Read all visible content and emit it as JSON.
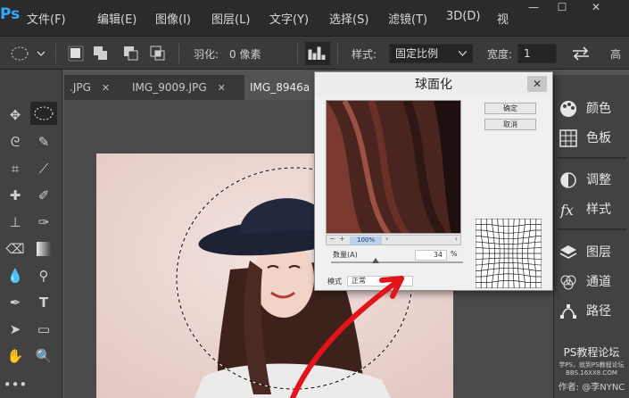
{
  "app": {
    "logo": "Ps"
  },
  "menu": [
    "文件(F)",
    "编辑(E)",
    "图像(I)",
    "图层(L)",
    "文字(Y)",
    "选择(S)",
    "滤镜(T)",
    "3D(D)",
    "视"
  ],
  "window_controls": [
    "—",
    "☐",
    "✕"
  ],
  "options": {
    "feather_label": "羽化:",
    "feather_value": "0 像素",
    "style_label": "样式:",
    "style_value": "固定比例",
    "width_label": "宽度:",
    "width_value": "1",
    "height_label": "高"
  },
  "tabs": [
    {
      "label": ".JPG",
      "close": "✕"
    },
    {
      "label": "IMG_9009.JPG",
      "close": "✕"
    },
    {
      "label": "IMG_8946a",
      "close": ""
    }
  ],
  "panels": [
    {
      "label": "颜色",
      "icon": "palette-icon"
    },
    {
      "label": "色板",
      "icon": "swatches-icon"
    },
    {
      "label": "调整",
      "icon": "adjustments-icon"
    },
    {
      "label": "样式",
      "icon": "styles-icon"
    },
    {
      "label": "图层",
      "icon": "layers-icon"
    },
    {
      "label": "通道",
      "icon": "channels-icon"
    },
    {
      "label": "路径",
      "icon": "paths-icon"
    }
  ],
  "watermark": {
    "title": "PS教程论坛",
    "line1": "学PS，就到PS教程论坛",
    "line2": "BBS.16XX8.COM",
    "author": "作者: @李NYNC"
  },
  "dialog": {
    "title": "球面化",
    "close": "✕",
    "ok_label": "确定",
    "cancel_label": "取消",
    "zoom_value": "100%",
    "amount_label": "数量(A)",
    "amount_value": "34",
    "amount_unit": "%",
    "amount_fraction": 0.34,
    "mode_label": "模式",
    "mode_value": "正常"
  },
  "colors": {
    "accent": "#31a8ff",
    "arrow": "#e0141a"
  }
}
